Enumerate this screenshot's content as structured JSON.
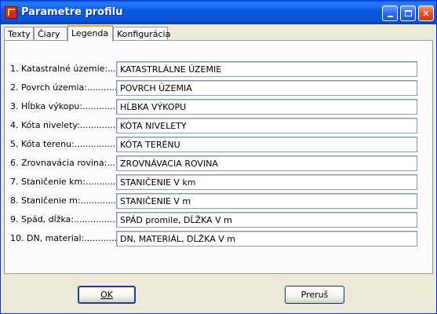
{
  "window": {
    "title": "Parametre profilu",
    "minimize_label": "_",
    "maximize_label": "□",
    "close_label": "✕"
  },
  "tabs": [
    {
      "label": "Texty",
      "active": false
    },
    {
      "label": "Čiary",
      "active": false
    },
    {
      "label": "Legenda",
      "active": true
    },
    {
      "label": "Konfigurácia",
      "active": false
    }
  ],
  "legend_rows": [
    {
      "label": "1. Katastralné územie:...........",
      "value": "KATASTRLÁLNE ÚZEMIE"
    },
    {
      "label": "2. Povrch územia:...................",
      "value": "POVRCH ÚZEMIA"
    },
    {
      "label": "3. Hĺbka výkopu:....................",
      "value": "HĹBKA VÝKOPU"
    },
    {
      "label": "4. Kóta nivelety:....................",
      "value": "KÓTA NIVELETY"
    },
    {
      "label": "5. Kóta terenu:........................",
      "value": "KÓTA TERÉNU"
    },
    {
      "label": "6. Zrovnavácia rovina:.........",
      "value": "ZROVNÁVACIA ROVINA"
    },
    {
      "label": "7. Staničenie km:.....................",
      "value": "STANIČENIE V km"
    },
    {
      "label": "8. Staničenie m:......................",
      "value": "STANIČENIE V m"
    },
    {
      "label": "9. Spád, dĺžka:........................",
      "value": "SPÁD promile, DĹŽKA V m"
    },
    {
      "label": "10. DN, material:....................",
      "value": "DN, MATERIÁL, DĹŽKA V m"
    }
  ],
  "buttons": {
    "ok": "OK",
    "cancel": "Preruš"
  },
  "colors": {
    "titlebar": "#0b5ae2",
    "active_tab_accent": "#e5a33a",
    "dialog_bg": "#ece9d8"
  }
}
